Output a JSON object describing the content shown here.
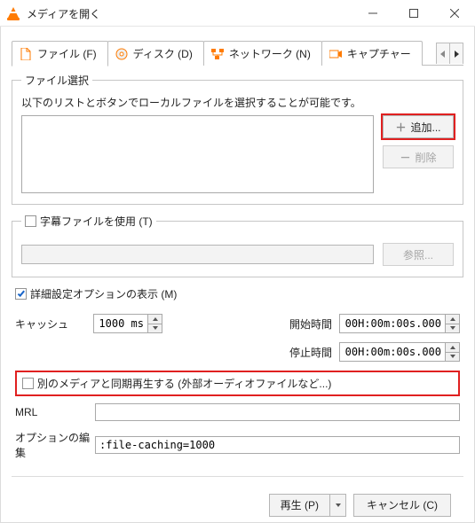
{
  "window": {
    "title": "メディアを開く"
  },
  "tabs": {
    "file": "ファイル (F)",
    "disc": "ディスク (D)",
    "network": "ネットワーク (N)",
    "capture": "キャプチャー"
  },
  "file_panel": {
    "legend": "ファイル選択",
    "hint": "以下のリストとボタンでローカルファイルを選択することが可能です。",
    "add": "追加...",
    "remove": "削除"
  },
  "subtitle": {
    "use_label": "字幕ファイルを使用 (T)",
    "browse": "参照..."
  },
  "advanced_toggle": "詳細設定オプションの表示 (M)",
  "advanced": {
    "cache_label": "キャッシュ",
    "cache_value": "1000 ms",
    "start_label": "開始時間",
    "start_value": "00H:00m:00s.000",
    "stop_label": "停止時間",
    "stop_value": "00H:00m:00s.000",
    "sync_label": "別のメディアと同期再生する (外部オーディオファイルなど...)",
    "mrl_label": "MRL",
    "mrl_value": "",
    "options_label": "オプションの編集",
    "options_value": ":file-caching=1000"
  },
  "buttons": {
    "play": "再生 (P)",
    "cancel": "キャンセル (C)"
  }
}
